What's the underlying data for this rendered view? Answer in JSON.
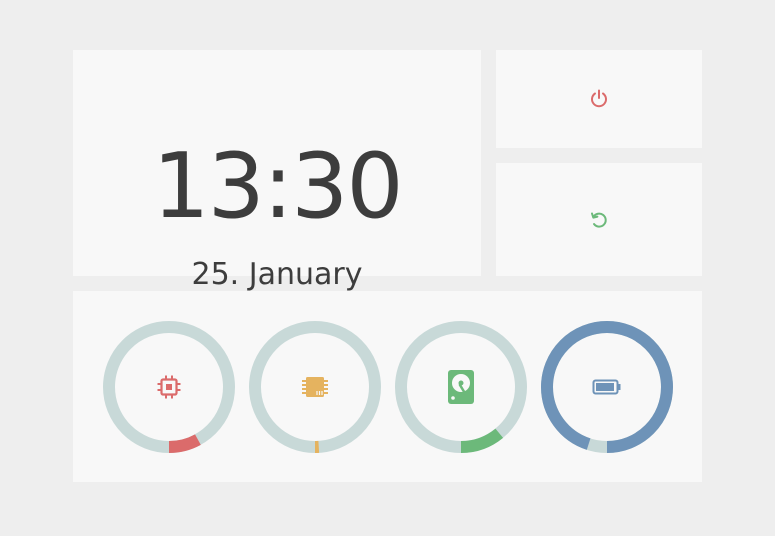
{
  "clock": {
    "time": "13:30",
    "date": "25. January"
  },
  "actions": {
    "power": {
      "icon": "power-icon",
      "color": "#db6b6b"
    },
    "reboot": {
      "icon": "refresh-icon",
      "color": "#6cb97a"
    }
  },
  "gauges": [
    {
      "name": "cpu",
      "icon": "cpu-icon",
      "color": "#db6b6b",
      "track": "#c8d9d8",
      "value": 0.08
    },
    {
      "name": "ram",
      "icon": "memory-icon",
      "color": "#e5b35f",
      "track": "#c8d9d8",
      "value": 0.01
    },
    {
      "name": "disk",
      "icon": "harddisk-icon",
      "color": "#6cb97a",
      "track": "#c8d9d8",
      "value": 0.11
    },
    {
      "name": "battery",
      "icon": "battery-icon",
      "color": "#6e93b8",
      "track": "#c8d9d8",
      "value": 0.95
    }
  ]
}
